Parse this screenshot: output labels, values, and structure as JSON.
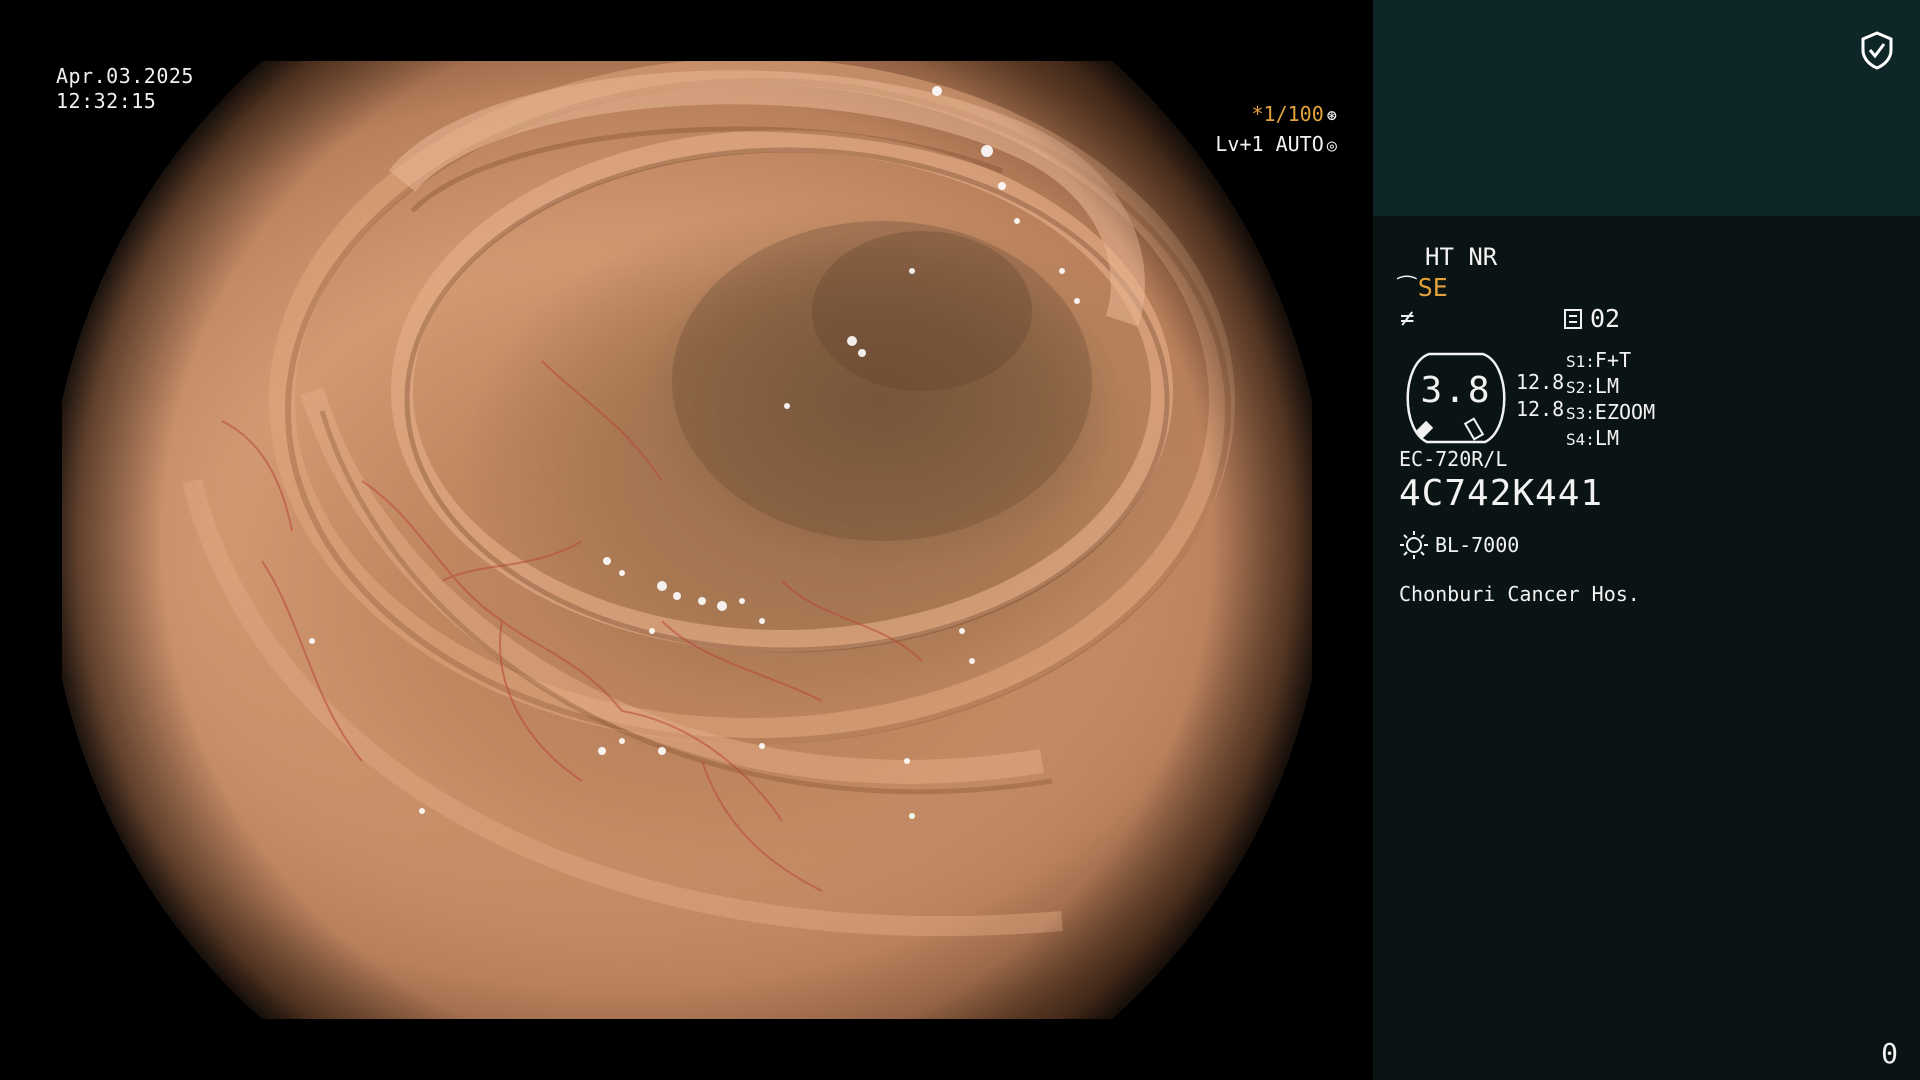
{
  "overlay": {
    "date": "Apr.03.2025",
    "time": "12:32:15",
    "shutter": "*1/100",
    "enhance": "Lv+1 AUTO"
  },
  "panel": {
    "ht_nr": "HT NR",
    "structure_enhance": "SE",
    "mode_number": "02",
    "zoom_value": "3.8",
    "reading_1": "12.8",
    "reading_2": "12.8",
    "switches": [
      {
        "id": "S1:",
        "value": "F+T"
      },
      {
        "id": "S2:",
        "value": "LM"
      },
      {
        "id": "S3:",
        "value": "EZOOM"
      },
      {
        "id": "S4:",
        "value": "LM"
      }
    ],
    "scope_model": "EC-720R/L",
    "scope_serial": "4C742K441",
    "light_source": "BL-7000",
    "hospital": "Chonburi Cancer Hos.",
    "counter": "0"
  },
  "colors": {
    "accent_orange": "#e3a23b",
    "panel_bg": "#0b1414",
    "panel_header_bg": "#0e2628"
  },
  "icons": {
    "shield": "shield-check-icon",
    "light": "light-source-icon",
    "mode": "mode-list-icon"
  }
}
